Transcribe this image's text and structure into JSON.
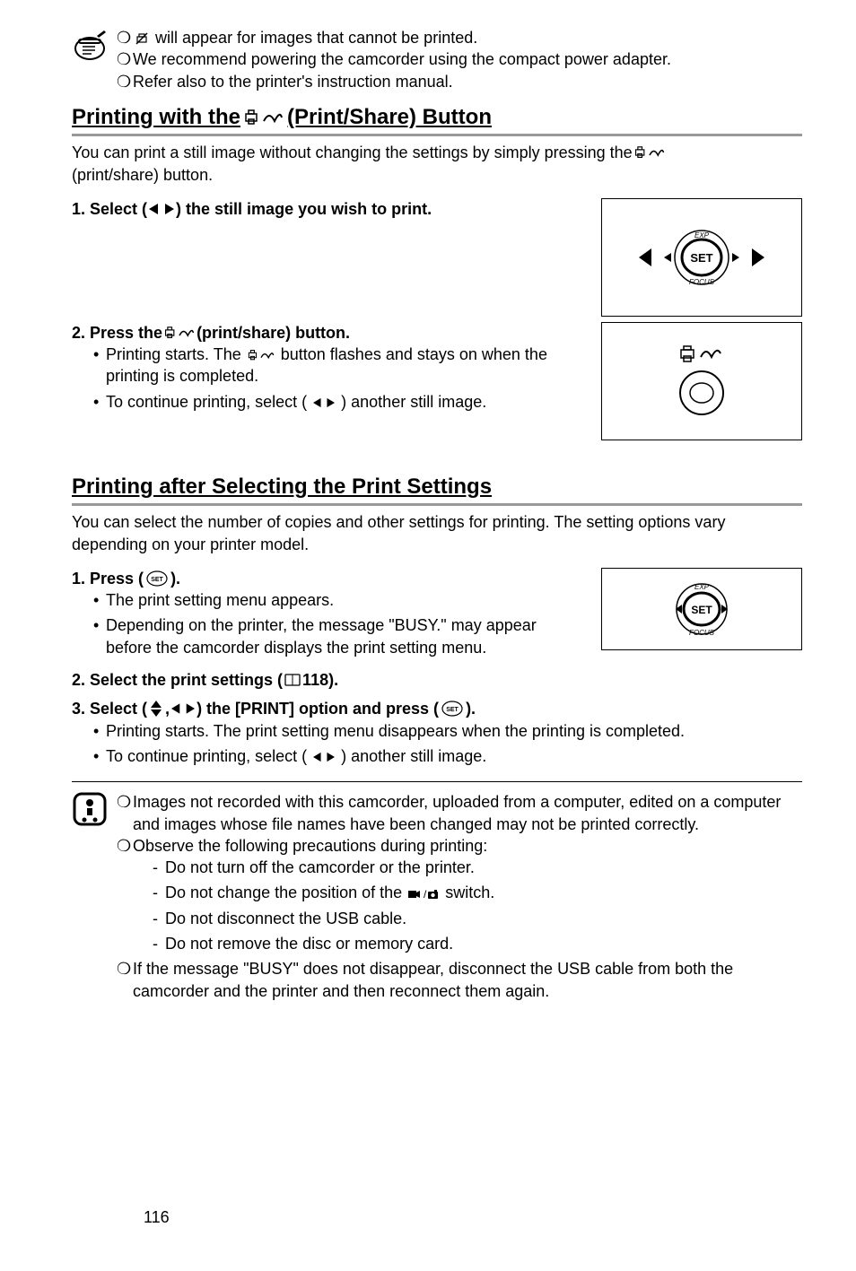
{
  "notes": {
    "n1": " will appear for images that cannot be printed.",
    "n2": "We recommend powering the camcorder using the compact power adapter.",
    "n3": "Refer also to the printer's instruction manual."
  },
  "section1": {
    "title_a": "Printing with the ",
    "title_b": " (Print/Share) Button",
    "intro_a": "You can print a still image without changing the settings by simply pressing the ",
    "intro_b": " (print/share) button.",
    "step1": "1.  Select (",
    "step1b": ") the still image you wish to print.",
    "step2a": "2.  Press the ",
    "step2b": " (print/share) button.",
    "s2_b1a": "Printing starts. The ",
    "s2_b1b": " button flashes and stays on when the printing is completed.",
    "s2_b2a": "To continue printing, select (",
    "s2_b2b": ") another still image."
  },
  "section2": {
    "title": "Printing after Selecting the Print Settings",
    "intro": "You can select the number of copies and other settings for printing. The setting options vary depending on your printer model.",
    "step1a": "1.  Press (",
    "step1b": ").",
    "s1_b1": "The print setting menu appears.",
    "s1_b2": "Depending on the printer, the message \"BUSY.\" may appear before the camcorder displays the print setting menu.",
    "step2a": "2.  Select the print settings (",
    "step2b": " 118).",
    "step3a": "3.  Select (",
    "step3b": ", ",
    "step3c": ") the [PRINT] option and press (",
    "step3d": ").",
    "s3_b1": "Printing starts. The print setting menu disappears when the printing is completed.",
    "s3_b2a": "To continue printing, select (",
    "s3_b2b": ") another still image."
  },
  "caution": {
    "c1": "Images not recorded with this camcorder, uploaded from a computer, edited on a computer and images whose file names have been changed may not be printed correctly.",
    "c2": "Observe the following precautions during printing:",
    "c2a": "Do not turn off the camcorder or the printer.",
    "c2b_a": "Do not change the position of the ",
    "c2b_b": " switch.",
    "c2c": "Do not disconnect the USB cable.",
    "c2d": "Do not remove the disc or memory card.",
    "c3": "If the message \"BUSY\" does not disappear, disconnect the USB cable from both the camcorder and the printer and then reconnect them again."
  },
  "pageNumber": "116"
}
